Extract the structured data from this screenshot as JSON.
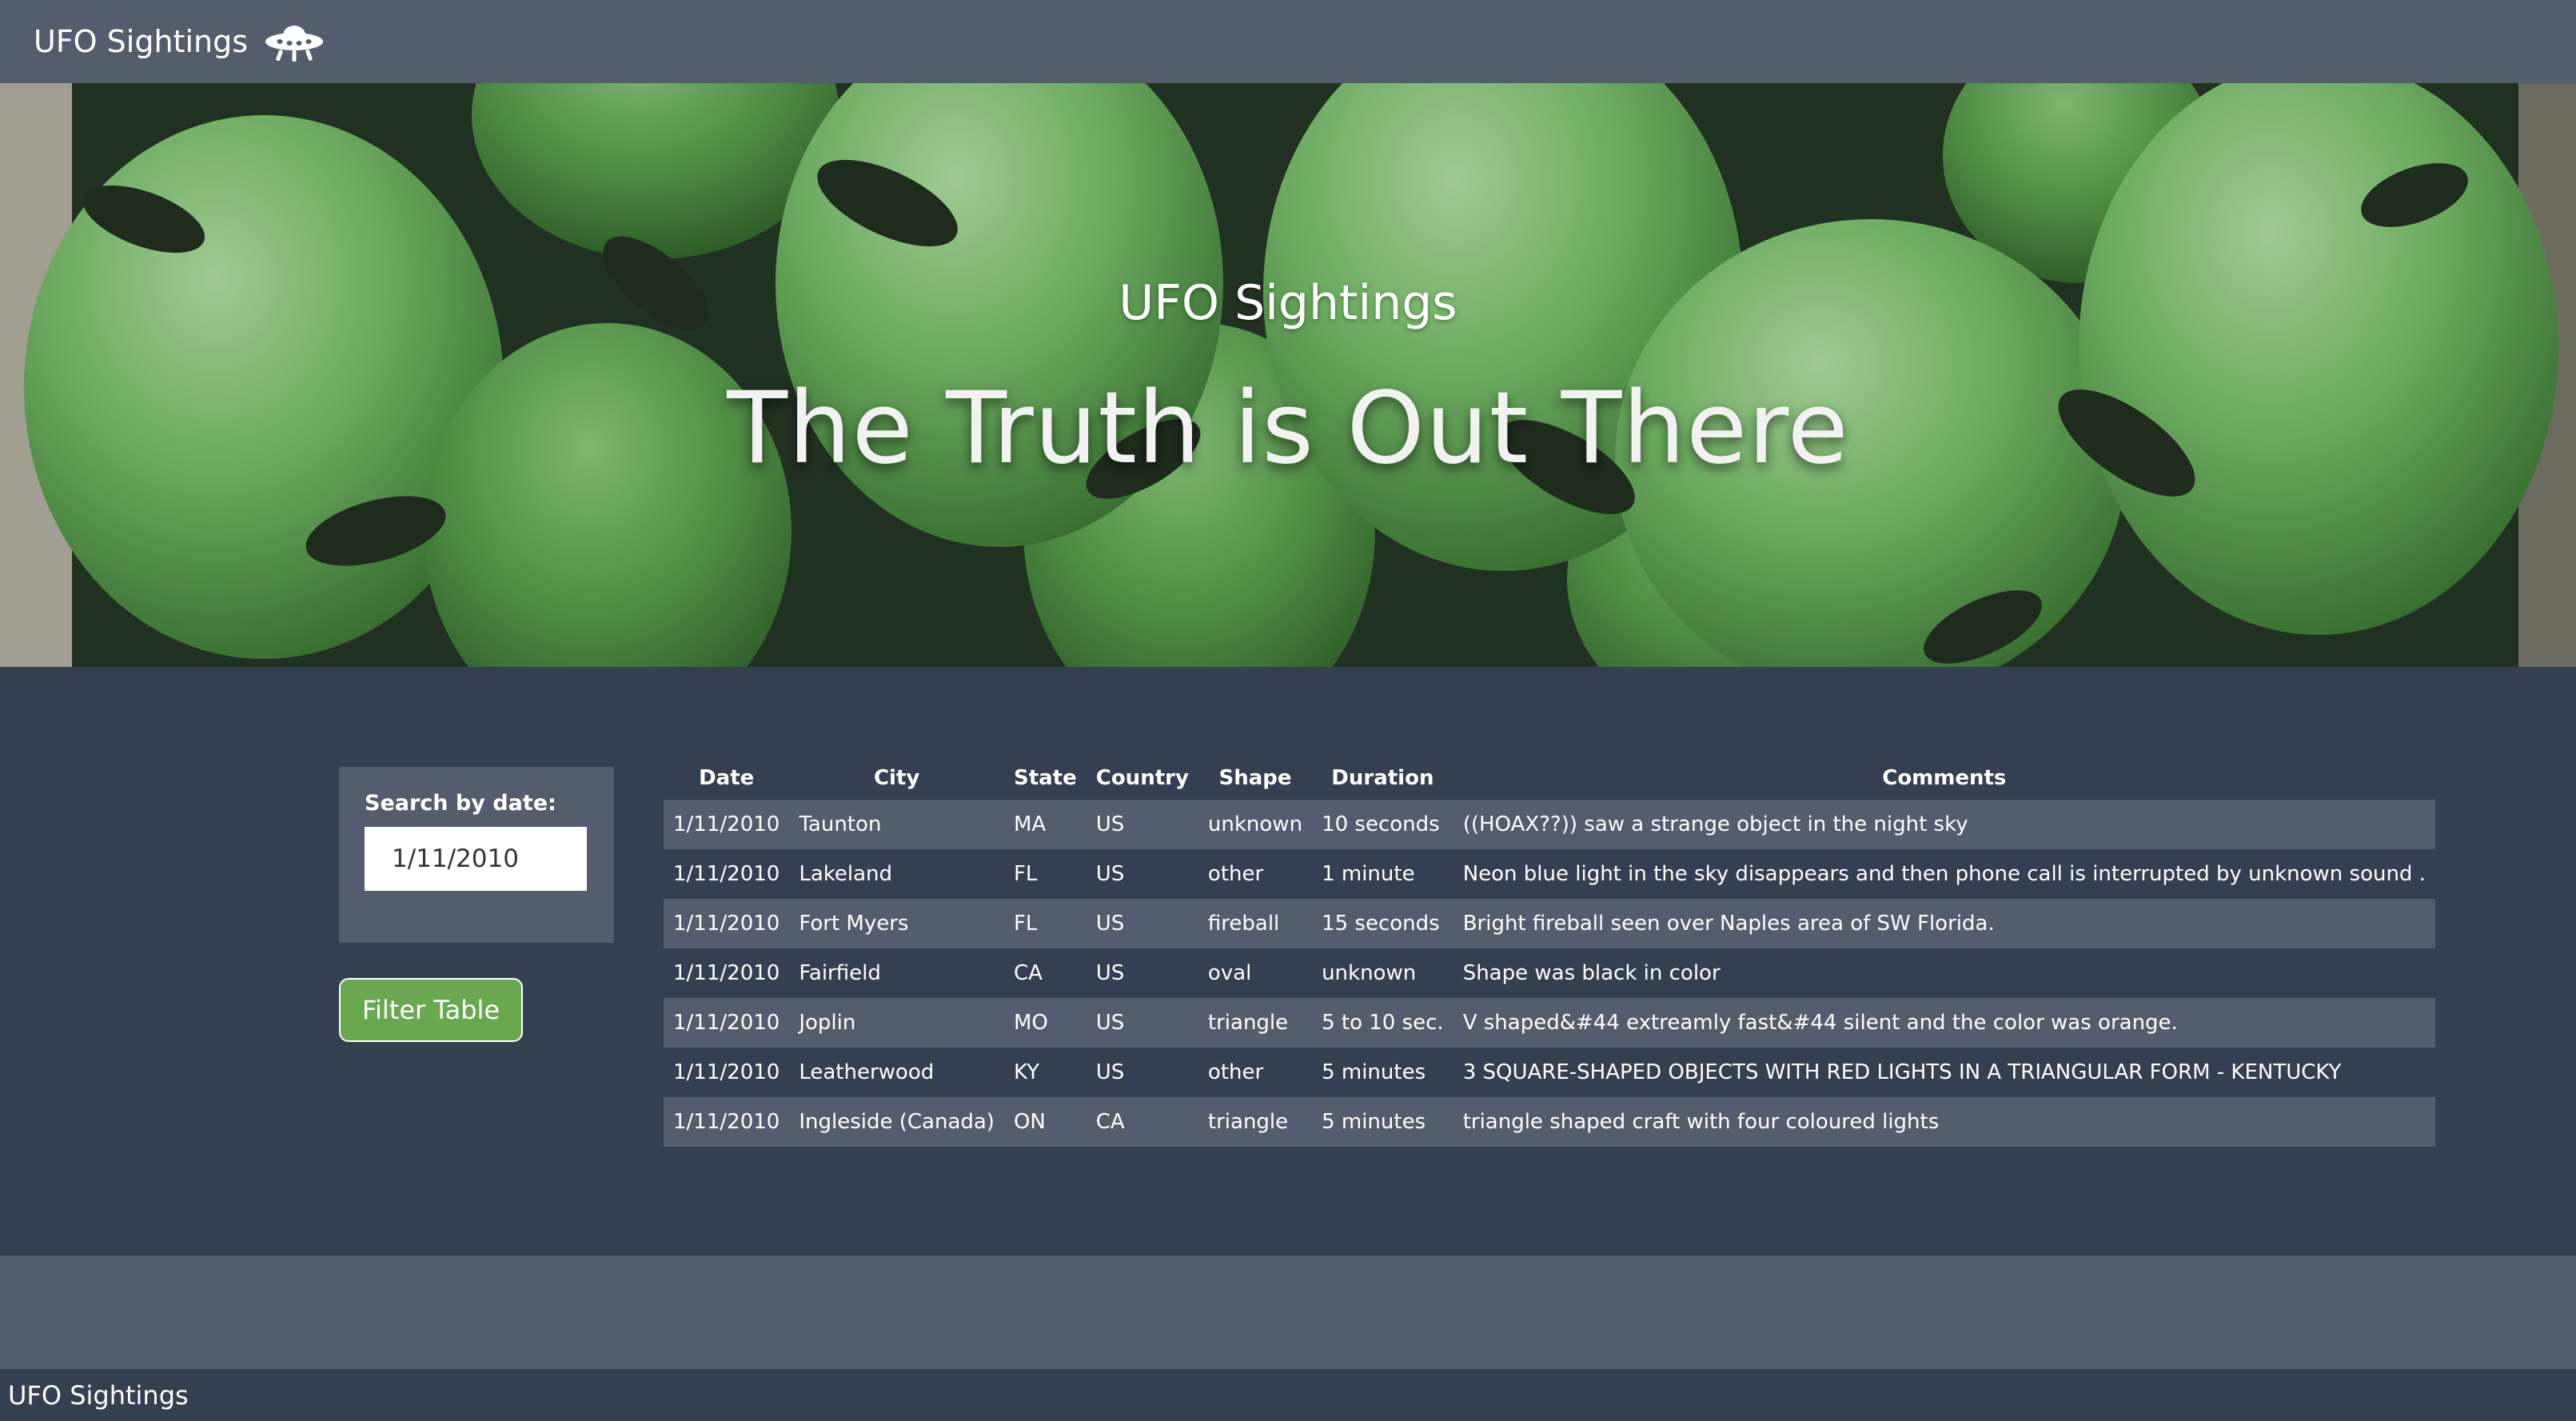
{
  "navbar": {
    "brand": "UFO Sightings",
    "icon": "ufo-icon"
  },
  "hero": {
    "subtitle": "UFO Sightings",
    "title": "The Truth is Out There",
    "background": "alien-figures-photo"
  },
  "filter": {
    "label": "Search by date:",
    "value": "1/11/2010",
    "button_label": "Filter Table"
  },
  "table": {
    "headers": [
      "Date",
      "City",
      "State",
      "Country",
      "Shape",
      "Duration",
      "Comments"
    ],
    "rows": [
      [
        "1/11/2010",
        "Taunton",
        "MA",
        "US",
        "unknown",
        "10 seconds",
        "((HOAX??)) saw a strange object in the night sky"
      ],
      [
        "1/11/2010",
        "Lakeland",
        "FL",
        "US",
        "other",
        "1 minute",
        "Neon blue light in the sky disappears and then phone call is interrupted by unknown sound ."
      ],
      [
        "1/11/2010",
        "Fort Myers",
        "FL",
        "US",
        "fireball",
        "15 seconds",
        "Bright fireball seen over Naples area of SW Florida."
      ],
      [
        "1/11/2010",
        "Fairfield",
        "CA",
        "US",
        "oval",
        "unknown",
        "Shape was black in color"
      ],
      [
        "1/11/2010",
        "Joplin",
        "MO",
        "US",
        "triangle",
        "5 to 10 sec.",
        "V shaped&#44 extreamly fast&#44 silent and the color was orange."
      ],
      [
        "1/11/2010",
        "Leatherwood",
        "KY",
        "US",
        "other",
        "5 minutes",
        "3 SQUARE-SHAPED OBJECTS WITH RED LIGHTS IN A TRIANGULAR FORM - KENTUCKY"
      ],
      [
        "1/11/2010",
        "Ingleside (Canada)",
        "ON",
        "CA",
        "triangle",
        "5 minutes",
        "triangle shaped craft with four coloured lights"
      ]
    ]
  },
  "footer": {
    "text": "UFO Sightings"
  },
  "colors": {
    "navbar": "#535d6e",
    "page": "#343f51",
    "button": "#6aa84f",
    "row_alt": "#535d6e"
  }
}
